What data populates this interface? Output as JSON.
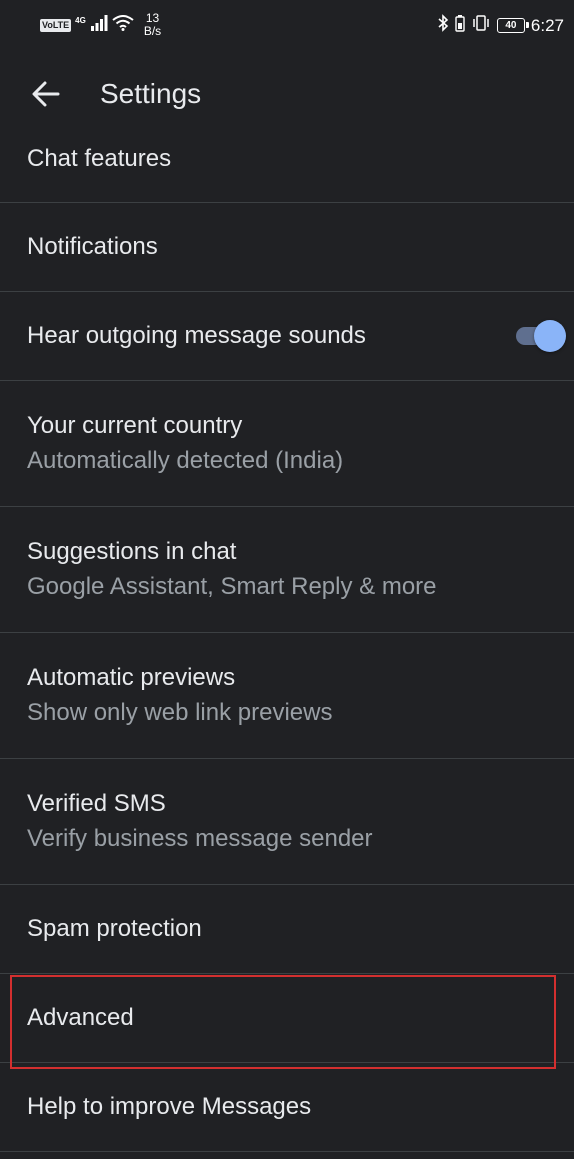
{
  "status_bar": {
    "volte": "VoLTE",
    "network": "4G",
    "speed_value": "13",
    "speed_unit": "B/s",
    "battery": "40",
    "time": "6:27"
  },
  "app_bar": {
    "title": "Settings"
  },
  "items": [
    {
      "title": "Chat features"
    },
    {
      "title": "Notifications"
    },
    {
      "title": "Hear outgoing message sounds",
      "toggle": true
    },
    {
      "title": "Your current country",
      "subtitle": "Automatically detected (India)"
    },
    {
      "title": "Suggestions in chat",
      "subtitle": "Google Assistant, Smart Reply & more"
    },
    {
      "title": "Automatic previews",
      "subtitle": "Show only web link previews"
    },
    {
      "title": "Verified SMS",
      "subtitle": "Verify business message sender"
    },
    {
      "title": "Spam protection"
    },
    {
      "title": "Advanced"
    },
    {
      "title": "Help to improve Messages"
    }
  ],
  "colors": {
    "background": "#202124",
    "toggle_on": "#8ab4f8",
    "highlight": "#d32f2f"
  }
}
